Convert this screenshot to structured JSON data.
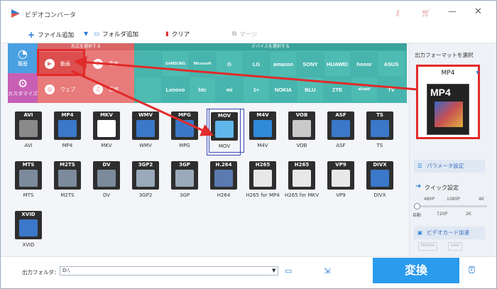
{
  "app": {
    "title": "ビデオコンバータ"
  },
  "titlebar": {
    "key_icon": "key-icon",
    "cart_icon": "cart-icon",
    "min_label": "—",
    "close_label": "✕"
  },
  "toolbar": {
    "add_file": "ファイル追加",
    "add_folder": "フォルダ追加",
    "clear": "クリア",
    "merge": "マージ"
  },
  "sidebar": {
    "history": "履歴",
    "custom": "カスタマイズ"
  },
  "format_panel": {
    "header": "形式を選択する",
    "categories": [
      "動画",
      "音楽",
      "ウェブ",
      "音楽"
    ]
  },
  "device_panel": {
    "header": "デバイスを選択する",
    "brands_row1": [
      "",
      "SAMSUNG",
      "Microsoft",
      "G",
      "LG",
      "amazon",
      "SONY",
      "HUAWEI",
      "honor",
      "ASUS"
    ],
    "brands_row2": [
      "",
      "Lenovo",
      "htc",
      "mi",
      "1+",
      "NOKIA",
      "BLU",
      "ZTE",
      "alcatel",
      "TV"
    ]
  },
  "formats": [
    {
      "badge": "AVI",
      "label": "AVI",
      "color": "#8a8a8a"
    },
    {
      "badge": "MP4",
      "label": "MP4",
      "color": "#3b78c9"
    },
    {
      "badge": "MKV",
      "label": "MKV",
      "color": "#ffffff"
    },
    {
      "badge": "WMV",
      "label": "WMV",
      "color": "#3b78c9"
    },
    {
      "badge": "MPG",
      "label": "MPG",
      "color": "#3b78c9"
    },
    {
      "badge": "MOV",
      "label": "MOV",
      "color": "#5fb6ea"
    },
    {
      "badge": "M4V",
      "label": "M4V",
      "color": "#2f8ad8"
    },
    {
      "badge": "VOB",
      "label": "VOB",
      "color": "#c9c9c9"
    },
    {
      "badge": "ASF",
      "label": "ASF",
      "color": "#3b78c9"
    },
    {
      "badge": "TS",
      "label": "TS",
      "color": "#3b78c9"
    },
    {
      "badge": "MTS",
      "label": "MTS",
      "color": "#7c8a9c"
    },
    {
      "badge": "M2TS",
      "label": "M2TS",
      "color": "#7c8a9c"
    },
    {
      "badge": "DV",
      "label": "DV",
      "color": "#7c8a9c"
    },
    {
      "badge": "3GP2",
      "label": "3GP2",
      "color": "#9aaabb"
    },
    {
      "badge": "3GP",
      "label": "3GP",
      "color": "#9aaabb"
    },
    {
      "badge": "H.264",
      "label": "H264",
      "color": "#5a7ab0"
    },
    {
      "badge": "H265",
      "label": "H265 for MP4",
      "color": "#e8e8e8"
    },
    {
      "badge": "H265",
      "label": "H265 for MKV",
      "color": "#e8e8e8"
    },
    {
      "badge": "VP9",
      "label": "VP9",
      "color": "#e8e8e8"
    },
    {
      "badge": "DIVX",
      "label": "DIVX",
      "color": "#3b78c9"
    },
    {
      "badge": "XVID",
      "label": "XVID",
      "color": "#3b78c9"
    }
  ],
  "right_panel": {
    "title": "出力フォーマットを選択",
    "selected_format": "MP4",
    "thumb_label": "MP4",
    "params": "パラメータ設定",
    "quick": "クイック設定",
    "slider_top": [
      "480P",
      "1080P",
      "4K"
    ],
    "slider_bottom": [
      "自動",
      "720P",
      "2K"
    ],
    "gpu": "ビデオカード加速",
    "gpu_chips": [
      "NVIDIA",
      "Intel"
    ]
  },
  "bottom": {
    "output_label": "出力フォルダ：",
    "output_value": "D:\\",
    "convert": "変換"
  }
}
